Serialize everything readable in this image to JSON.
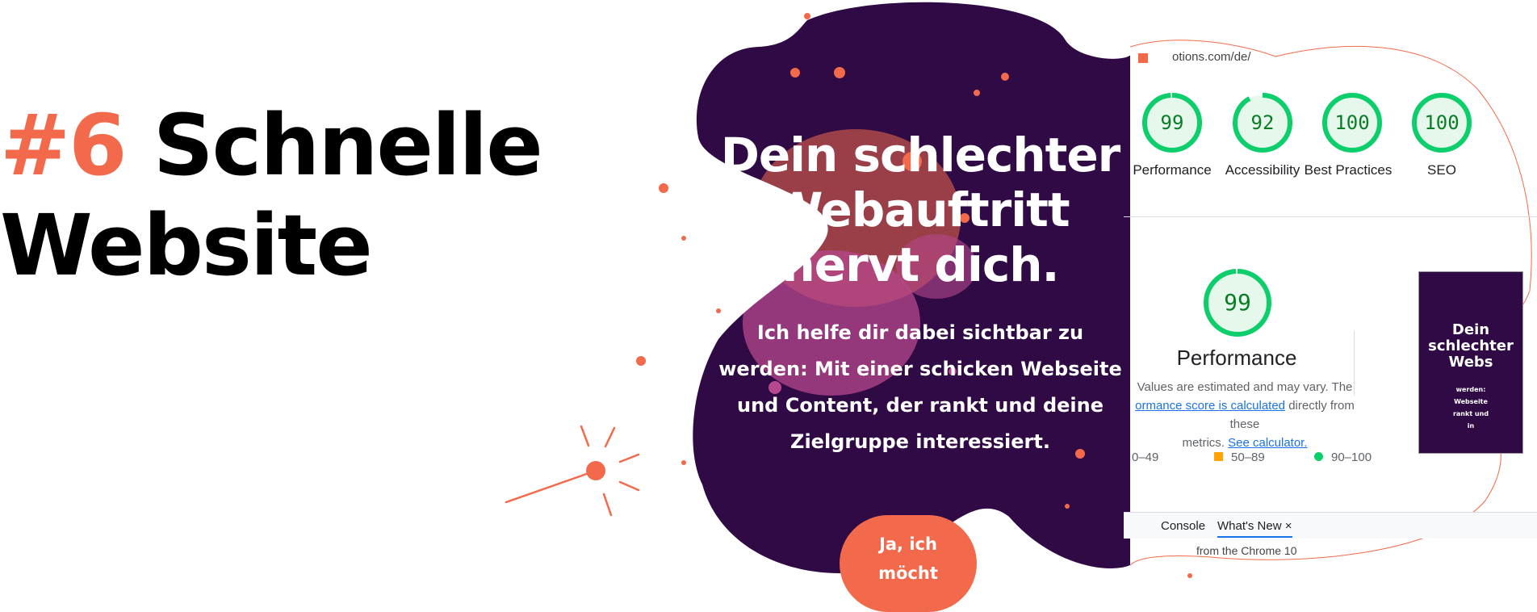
{
  "heading": {
    "number": "#6",
    "line1": "Schnelle",
    "line2": "Website"
  },
  "hero": {
    "title_lines": [
      "Dein schlechter",
      "Webauftritt",
      "nervt dich."
    ],
    "subtitle_lines": [
      "Ich helfe dir dabei sichtbar zu",
      "werden: Mit einer schicken Webseite",
      "und Content, der rankt und deine",
      "Zielgruppe interessiert."
    ],
    "cta_lines": [
      "Ja, ich",
      "möcht"
    ]
  },
  "lighthouse": {
    "url": "otions.com/de/",
    "scores": [
      {
        "value": "99",
        "label": "Performance"
      },
      {
        "value": "92",
        "label": "Accessibility"
      },
      {
        "value": "100",
        "label": "Best Practices"
      },
      {
        "value": "100",
        "label": "SEO"
      }
    ],
    "performance": {
      "score": "99",
      "title": "Performance",
      "note_1": "Values are estimated and may vary. The",
      "link_1": "ormance score is calculated",
      "note_2": " directly from these",
      "note_3": "metrics. ",
      "link_2": "See calculator."
    },
    "legend": [
      {
        "range": "0–49"
      },
      {
        "range": "50–89"
      },
      {
        "range": "90–100"
      }
    ],
    "tabs": [
      {
        "label": "Console"
      },
      {
        "label": "What's New"
      }
    ],
    "tab_close": "×",
    "bottom_text": "from the Chrome 10",
    "thumb": {
      "title_lines": [
        "Dein",
        "schlechter",
        "Webs"
      ],
      "text_lines": [
        "werden:",
        "Webseite",
        "rankt und",
        "in"
      ]
    }
  },
  "colors": {
    "accent": "#f26a4b",
    "hero_bg": "#2f0a45",
    "score_green": "#0cce6b",
    "splash_pink": "#b7488e"
  }
}
